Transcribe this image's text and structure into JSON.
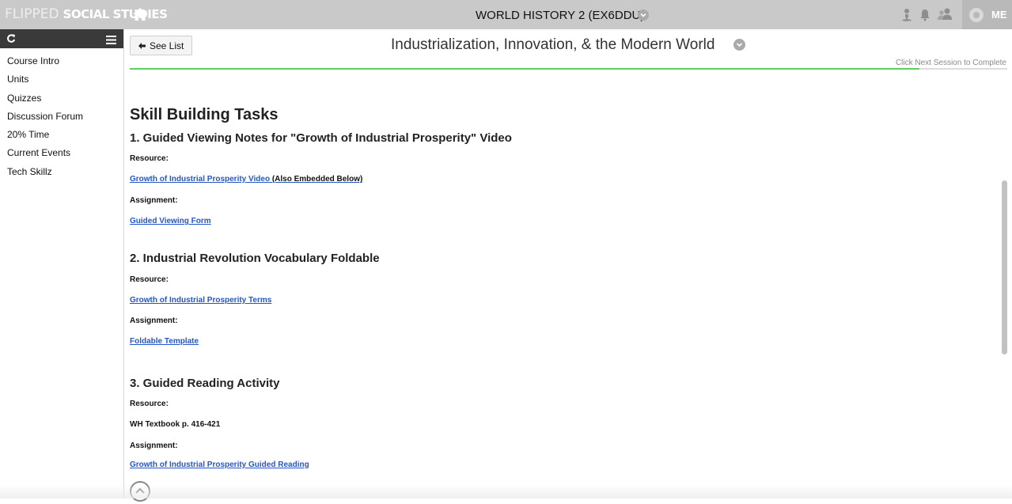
{
  "topbar": {
    "brand_part1": "FLIPPED",
    "brand_part2": "SOCIAL STUDIES",
    "course_title": "WORLD HISTORY 2 (EX6DDU)",
    "me_label": "ME"
  },
  "sidebar": {
    "items": [
      {
        "label": "Course Intro"
      },
      {
        "label": "Units"
      },
      {
        "label": "Quizzes"
      },
      {
        "label": "Discussion Forum"
      },
      {
        "label": "20% Time"
      },
      {
        "label": "Current Events"
      },
      {
        "label": "Tech Skillz"
      }
    ]
  },
  "main": {
    "see_list_label": "See List",
    "page_title": "Industrialization, Innovation, & the Modern World",
    "progress_text": "Click Next Session to Complete",
    "progress_fraction": 0.9,
    "heading": "Skill Building Tasks",
    "tasks": [
      {
        "title": "1. Guided Viewing Notes for \"Growth of Industrial Prosperity\" Video",
        "resource_label": "Resource:",
        "resource_link": "Growth of Industrial Prosperity Video ",
        "resource_note": "(Also Embedded Below)",
        "assignment_label": "Assignment:",
        "assignment_link": "Guided Viewing Form "
      },
      {
        "title": "2. Industrial Revolution Vocabulary Foldable",
        "resource_label": "Resource:",
        "resource_link": "Growth of Industrial Prosperity Terms",
        "assignment_label": "Assignment:",
        "assignment_link": "Foldable Template"
      },
      {
        "title": "3. Guided Reading Activity",
        "resource_label": "Resource:",
        "resource_text": "WH Textbook p. 416-421",
        "assignment_label": "Assignment:",
        "assignment_link": "Growth of Industrial Prosperity Guided Reading"
      }
    ]
  },
  "colors": {
    "topbar": "#c9c9c9",
    "sidebar_header": "#3a3a3a",
    "link": "#2456c8",
    "progress": "#5ccf5c"
  },
  "icons": [
    "home-icon",
    "chevron-down-icon",
    "user-icon",
    "bell-icon",
    "users-icon",
    "refresh-icon",
    "menu-icon",
    "arrow-left-icon",
    "chevron-up-icon"
  ]
}
